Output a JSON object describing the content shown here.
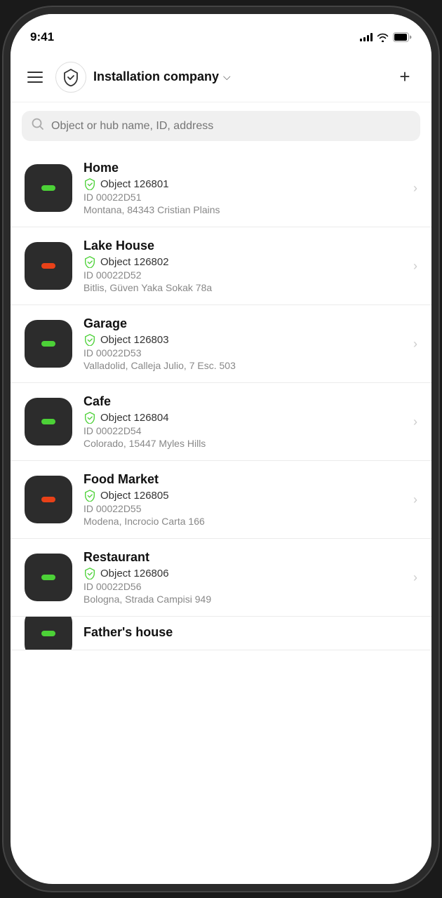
{
  "statusBar": {
    "time": "9:41"
  },
  "header": {
    "menuLabel": "Menu",
    "companyName": "Installation company",
    "addLabel": "+"
  },
  "search": {
    "placeholder": "Object or hub name, ID, address"
  },
  "items": [
    {
      "name": "Home",
      "objectLabel": "Object 126801",
      "id": "ID 00022D51",
      "address": "Montana, 84343 Cristian Plains",
      "ledColor": "green"
    },
    {
      "name": "Lake House",
      "objectLabel": "Object 126802",
      "id": "ID 00022D52",
      "address": "Bitlis, Güven Yaka Sokak 78a",
      "ledColor": "red"
    },
    {
      "name": "Garage",
      "objectLabel": "Object 126803",
      "id": "ID 00022D53",
      "address": "Valladolid, Calleja Julio, 7 Esc. 503",
      "ledColor": "green"
    },
    {
      "name": "Cafe",
      "objectLabel": "Object 126804",
      "id": "ID 00022D54",
      "address": "Colorado, 15447 Myles Hills",
      "ledColor": "green"
    },
    {
      "name": "Food Market",
      "objectLabel": "Object 126805",
      "id": "ID 00022D55",
      "address": "Modena, Incrocio Carta 166",
      "ledColor": "red"
    },
    {
      "name": "Restaurant",
      "objectLabel": "Object 126806",
      "id": "ID 00022D56",
      "address": "Bologna, Strada Campisi 949",
      "ledColor": "green"
    },
    {
      "name": "Father's house",
      "objectLabel": "",
      "id": "",
      "address": "",
      "ledColor": "green",
      "partial": true
    }
  ]
}
